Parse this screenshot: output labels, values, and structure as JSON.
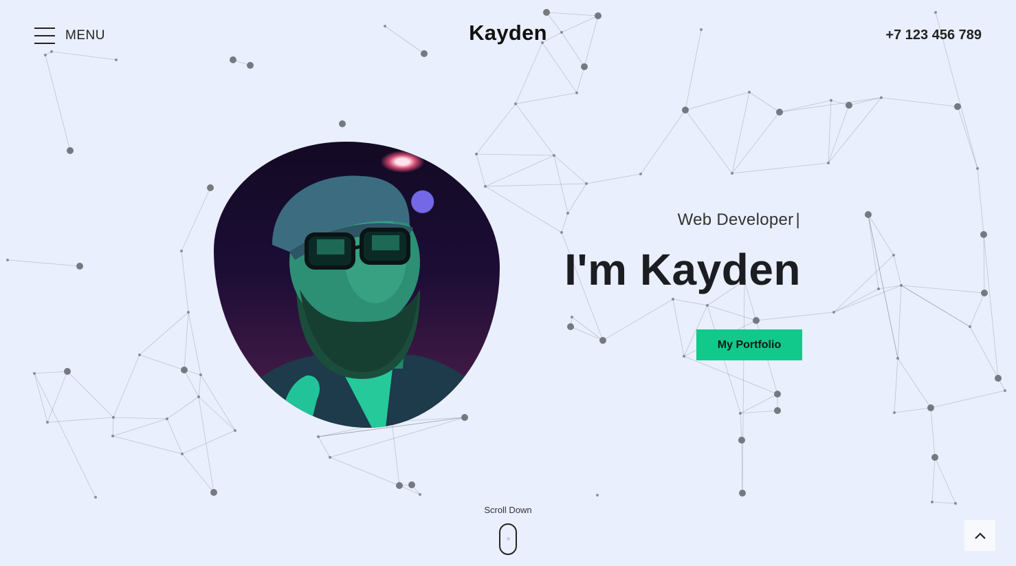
{
  "header": {
    "menu_label": "MENU",
    "logo": "Kayden",
    "phone": "+7 123 456 789"
  },
  "hero": {
    "role": "Web Developer",
    "cursor": "|",
    "headline": "I'm Kayden",
    "cta_label": "My Portfolio",
    "photo_alt": "portrait"
  },
  "scroll": {
    "label": "Scroll Down"
  },
  "icons": {
    "menu": "hamburger-icon",
    "scroll": "mouse-icon",
    "back_to_top": "chevron-up-icon"
  },
  "colors": {
    "background": "#e9effc",
    "accent": "#10c98a",
    "text": "#1f2228",
    "network": "#6f737a"
  }
}
